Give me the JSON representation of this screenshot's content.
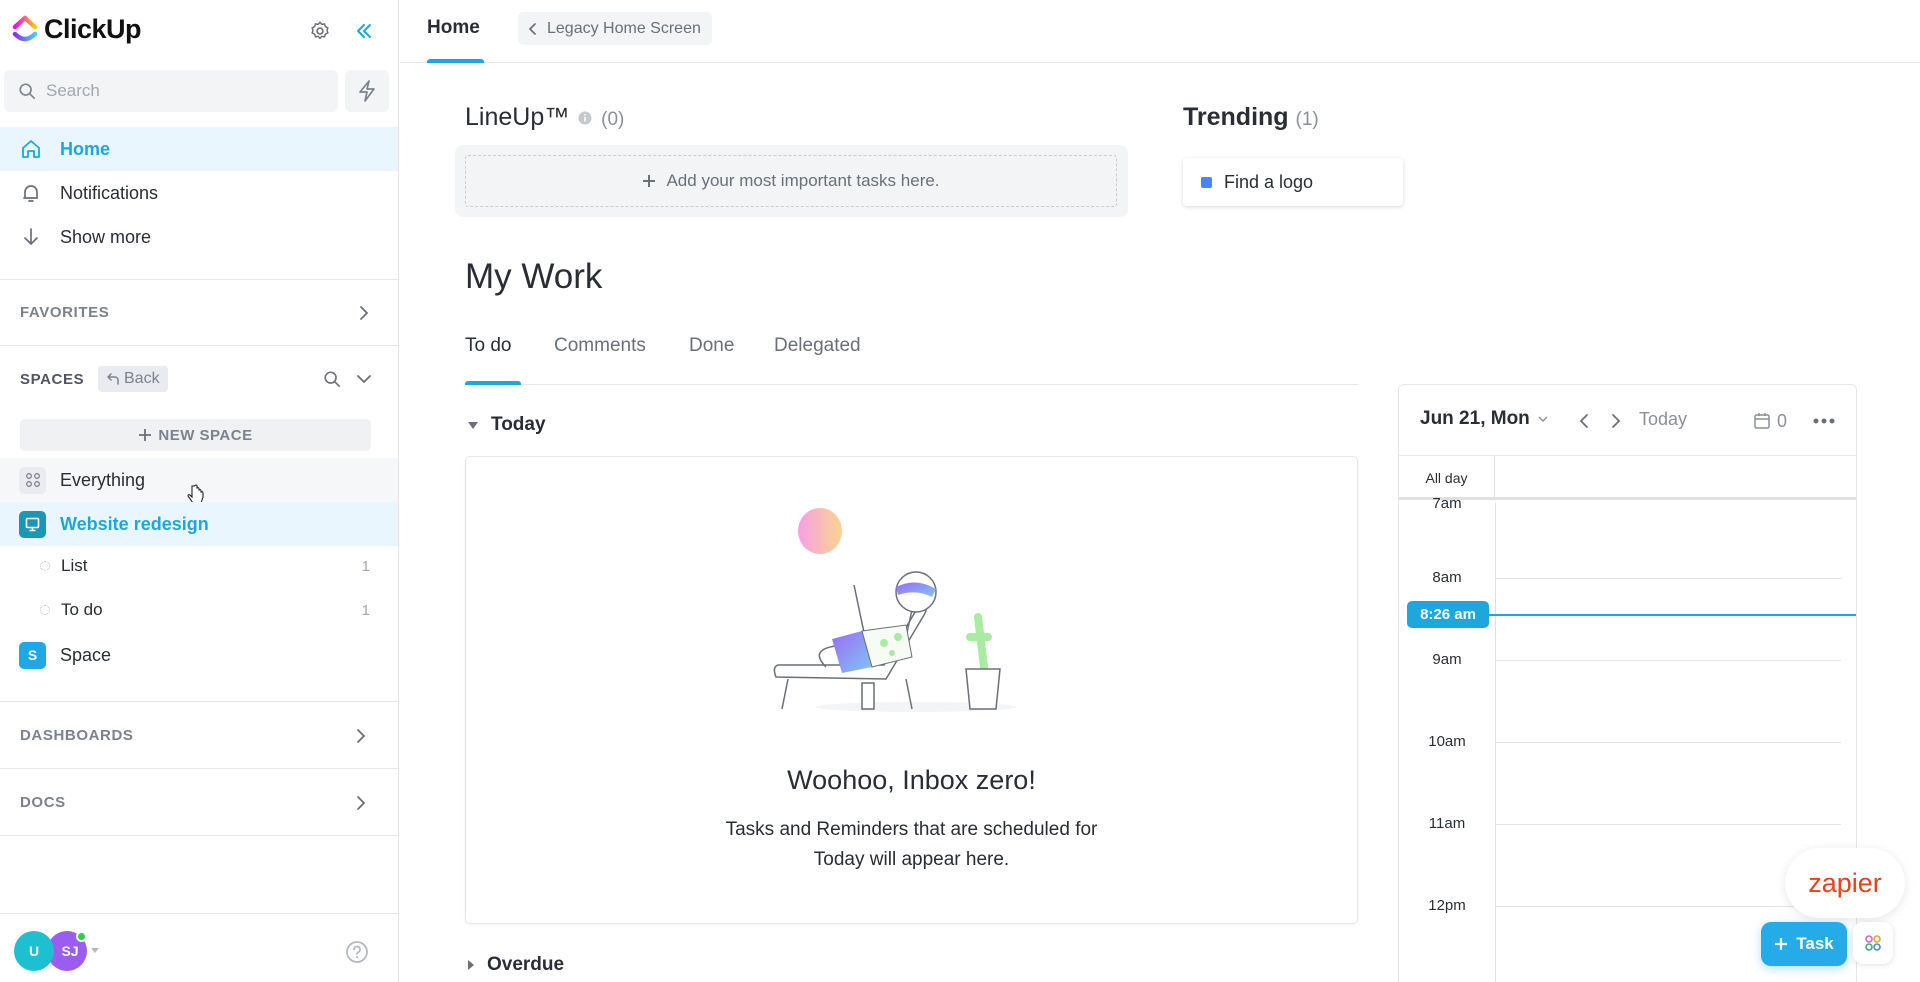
{
  "app": {
    "name": "ClickUp"
  },
  "sidebar": {
    "search_placeholder": "Search",
    "nav": [
      {
        "label": "Home",
        "icon": "home-icon",
        "active": true
      },
      {
        "label": "Notifications",
        "icon": "bell-icon"
      },
      {
        "label": "Show more",
        "icon": "arrow-down-icon"
      }
    ],
    "favorites_label": "FAVORITES",
    "spaces_label": "SPACES",
    "back_label": "Back",
    "new_space_label": "NEW SPACE",
    "everything_label": "Everything",
    "spaces": [
      {
        "label": "Website redesign",
        "badge": "",
        "color": "#1b97b3",
        "expanded": true,
        "lists": [
          {
            "label": "List",
            "count": "1"
          },
          {
            "label": "To do",
            "count": "1"
          }
        ]
      },
      {
        "label": "Space",
        "badge": "S",
        "color": "#1fa7e8",
        "expanded": false
      }
    ],
    "dashboards_label": "DASHBOARDS",
    "docs_label": "DOCS",
    "avatars": [
      {
        "initials": "U",
        "color": "#1ebfd1"
      },
      {
        "initials": "SJ",
        "color": "#9b5cf0",
        "online": true
      }
    ]
  },
  "topbar": {
    "home_tab": "Home",
    "legacy_button": "Legacy Home Screen"
  },
  "lineup": {
    "title": "LineUp™",
    "count": "(0)",
    "add_label": "Add your most important tasks here."
  },
  "trending": {
    "title": "Trending",
    "count": "(1)",
    "items": [
      {
        "label": "Find a logo",
        "color": "#4a86f0"
      }
    ]
  },
  "my_work": {
    "title": "My Work",
    "tabs": [
      {
        "label": "To do",
        "active": true
      },
      {
        "label": "Comments"
      },
      {
        "label": "Done"
      },
      {
        "label": "Delegated"
      }
    ],
    "groups": {
      "today": "Today",
      "overdue": "Overdue"
    },
    "empty_title": "Woohoo, Inbox zero!",
    "empty_line1": "Tasks and Reminders that are scheduled for",
    "empty_line2": "Today will appear here."
  },
  "calendar": {
    "date": "Jun 21, Mon",
    "today_label": "Today",
    "event_count": "0",
    "allday_label": "All day",
    "hours": [
      "7am",
      "8am",
      "9am",
      "10am",
      "11am",
      "12pm"
    ],
    "now_label": "8:26 am"
  },
  "floating": {
    "zapier_label": "zapier",
    "task_button": "Task"
  }
}
